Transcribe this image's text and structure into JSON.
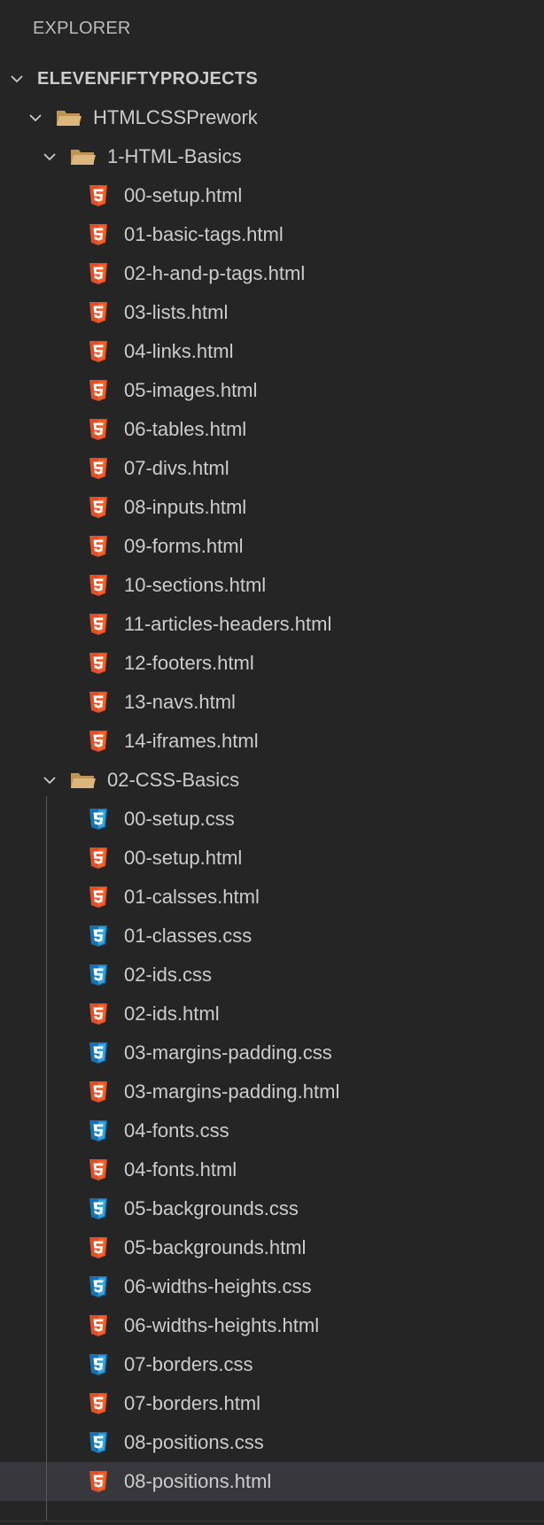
{
  "explorer": {
    "title": "EXPLORER"
  },
  "tree": {
    "root": "ELEVENFIFTYPROJECTS",
    "folder_level1": "HTMLCSSPrework",
    "folder_html_basics": "1-HTML-Basics",
    "html_basics_files": [
      "00-setup.html",
      "01-basic-tags.html",
      "02-h-and-p-tags.html",
      "03-lists.html",
      "04-links.html",
      "05-images.html",
      "06-tables.html",
      "07-divs.html",
      "08-inputs.html",
      "09-forms.html",
      "10-sections.html",
      "11-articles-headers.html",
      "12-footers.html",
      "13-navs.html",
      "14-iframes.html"
    ],
    "folder_css_basics": "02-CSS-Basics",
    "css_basics_files": [
      "00-setup.css",
      "00-setup.html",
      "01-calsses.html",
      "01-classes.css",
      "02-ids.css",
      "02-ids.html",
      "03-margins-padding.css",
      "03-margins-padding.html",
      "04-fonts.css",
      "04-fonts.html",
      "05-backgrounds.css",
      "05-backgrounds.html",
      "06-widths-heights.css",
      "06-widths-heights.html",
      "07-borders.css",
      "07-borders.html",
      "08-positions.css",
      "08-positions.html"
    ],
    "selected_file": "08-positions.html"
  },
  "colors": {
    "background": "#252526",
    "text": "#cccccc",
    "selected_row": "#37373d",
    "html_icon": "#e44d26",
    "css_icon": "#1572b6",
    "folder_icon": "#dcb67a"
  },
  "icons": {
    "chevron": "chevron-down-icon",
    "folder": "folder-open-icon",
    "html": "html5-file-icon",
    "css": "css3-file-icon"
  }
}
